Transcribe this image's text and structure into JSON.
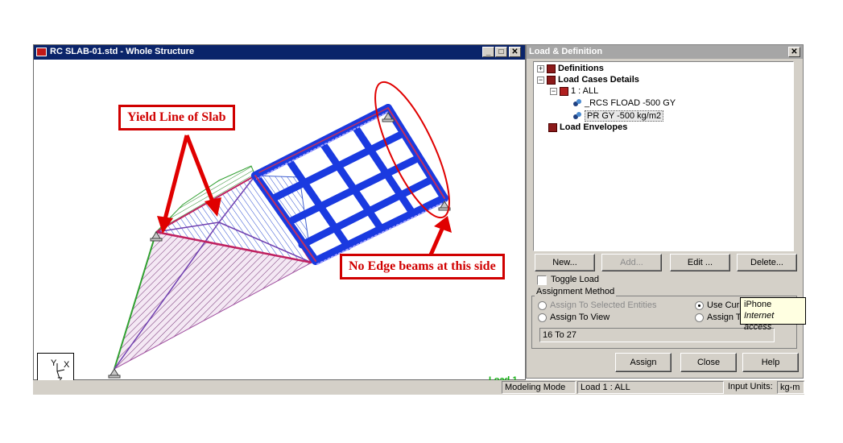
{
  "window": {
    "title": "RC SLAB-01.std - Whole Structure",
    "minimize": "_",
    "restore": "□",
    "close": "✕",
    "load_label": "Load 1",
    "axis": {
      "y": "Y",
      "x": "X",
      "z": "Z"
    }
  },
  "annotations": {
    "yield_line": "Yield Line of Slab",
    "no_edge": "No Edge beams at this side",
    "accent_color": "#d00000"
  },
  "panel": {
    "title": "Load & Definition",
    "close": "✕",
    "tree": [
      {
        "label": "Definitions",
        "expander": "+"
      },
      {
        "label": "Load Cases Details",
        "expander": "−"
      },
      {
        "label": "1 : ALL",
        "expander": "−"
      },
      {
        "label": "_RCS FLOAD -500 GY"
      },
      {
        "label": "PR GY -500  kg/m2"
      },
      {
        "label": "Load Envelopes"
      }
    ],
    "buttons": {
      "new": "New...",
      "add": "Add...",
      "edit": "Edit ...",
      "delete": "Delete..."
    },
    "toggle_load": "Toggle Load",
    "assignment": {
      "label": "Assignment Method",
      "to_selected": "Assign To Selected Entities",
      "to_view": "Assign To View",
      "use_cursor": "Use Curs",
      "assign_t": "Assign T",
      "range": "16 To 27"
    },
    "tooltip": {
      "line1": "iPhone",
      "line2": "Internet access"
    },
    "actions": {
      "assign": "Assign",
      "close": "Close",
      "help": "Help"
    }
  },
  "status": {
    "mode": "Modeling Mode",
    "load": "Load 1 : ALL",
    "units_label": "Input Units:",
    "units": "kg-m"
  }
}
